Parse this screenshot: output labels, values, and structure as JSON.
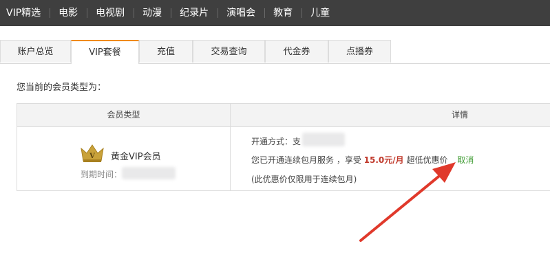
{
  "topnav": {
    "items": [
      "VIP精选",
      "电影",
      "电视剧",
      "动漫",
      "纪录片",
      "演唱会",
      "教育",
      "儿童"
    ]
  },
  "tabs": {
    "items": [
      "账户总览",
      "VIP套餐",
      "充值",
      "交易查询",
      "代金券",
      "点播券"
    ],
    "active": "VIP套餐"
  },
  "intro_text": "您当前的会员类型为：",
  "table": {
    "headers": {
      "type": "会员类型",
      "details": "详情"
    },
    "member_name": "黄金VIP会员",
    "expiry_label": "到期时间：",
    "open_method_label": "开通方式：支",
    "service_prefix": "您已开通连续包月服务 ，享受",
    "price": "15.0元/月",
    "service_suffix": "超低优惠价",
    "cancel_label": "取消",
    "note": "(此优惠价仅限用于连续包月)"
  },
  "colors": {
    "nav_bg": "#3f3f3f",
    "active_tab_accent": "#f08a1c",
    "price": "#c0392b",
    "cancel": "#3c9a2f",
    "arrow": "#e0392b",
    "crown": "#c9a23a"
  },
  "icons": [
    "crown-icon",
    "red-arrow-annotation"
  ]
}
